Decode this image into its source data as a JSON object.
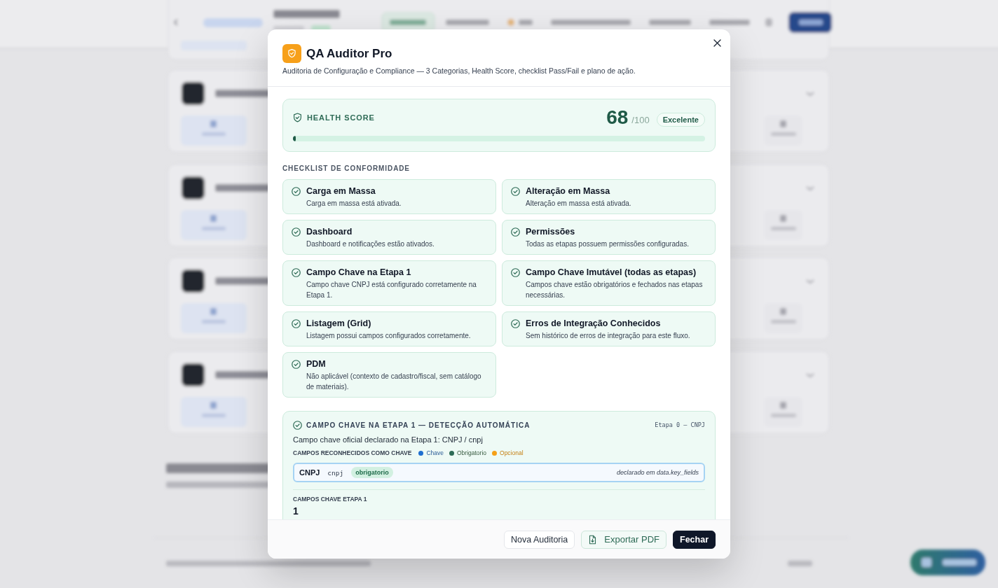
{
  "modal": {
    "title": "QA Auditor Pro",
    "subtitle": "Auditoria de Configuração e Compliance — 3 Categorias, Health Score, checklist Pass/Fail e plano de ação."
  },
  "health_score": {
    "label": "HEALTH SCORE",
    "score": "68",
    "max": "/100",
    "rating": "Excelente",
    "level": 0.007
  },
  "checklist": {
    "title": "CHECKLIST DE CONFORMIDADE",
    "items": [
      {
        "title": "Carga em Massa",
        "description": "Carga em massa está ativada.",
        "passed": true
      },
      {
        "title": "Alteração em Massa",
        "description": "Alteração em massa está ativada.",
        "passed": true
      },
      {
        "title": "Dashboard",
        "description": "Dashboard e notificações estão ativados.",
        "passed": true
      },
      {
        "title": "Permissões",
        "description": "Todas as etapas possuem permissões configuradas.",
        "passed": true
      },
      {
        "title": "Campo Chave na Etapa 1",
        "description": "Campo chave CNPJ está configurado corretamente na Etapa 1.",
        "passed": true
      },
      {
        "title": "Campo Chave Imutável (todas as etapas)",
        "description": "Campos chave estão obrigatórios e fechados nas etapas necessárias.",
        "passed": true
      },
      {
        "title": "Listagem (Grid)",
        "description": "Listagem possui campos configurados corretamente.",
        "passed": true
      },
      {
        "title": "Erros de Integração Conhecidos",
        "description": "Sem histórico de erros de integração para este fluxo.",
        "passed": true
      },
      {
        "title": "PDM",
        "description": "Não aplicável (contexto de cadastro/fiscal, sem catálogo de materiais).",
        "passed": true
      }
    ]
  },
  "detection": {
    "title": "CAMPO CHAVE NA ETAPA 1 — DETECÇÃO AUTOMÁTICA",
    "passed": true,
    "stage": "Etapa 0 — CNPJ",
    "summary": "Campo chave oficial declarado na Etapa 1: CNPJ / cnpj",
    "legend_title": "CAMPOS RECONHECIDOS COMO CHAVE",
    "legend": [
      {
        "label": "Chave",
        "color": "#1f6fd0"
      },
      {
        "label": "Obrigatorio",
        "color": "#2e6b56"
      },
      {
        "label": "Opcional",
        "color": "#f5a018"
      }
    ],
    "fields": [
      {
        "name": "CNPJ",
        "code": "cnpj",
        "badge": "obrigatorio",
        "source": "declarado em data.key_fields"
      }
    ],
    "count_label": "CAMPOS CHAVE ETAPA 1",
    "count": "1"
  },
  "footer": {
    "buttons": [
      {
        "label": "Nova Auditoria",
        "kind": "secondary"
      },
      {
        "label": "Exportar PDF",
        "kind": "export"
      },
      {
        "label": "Fechar",
        "kind": "primary"
      }
    ]
  }
}
